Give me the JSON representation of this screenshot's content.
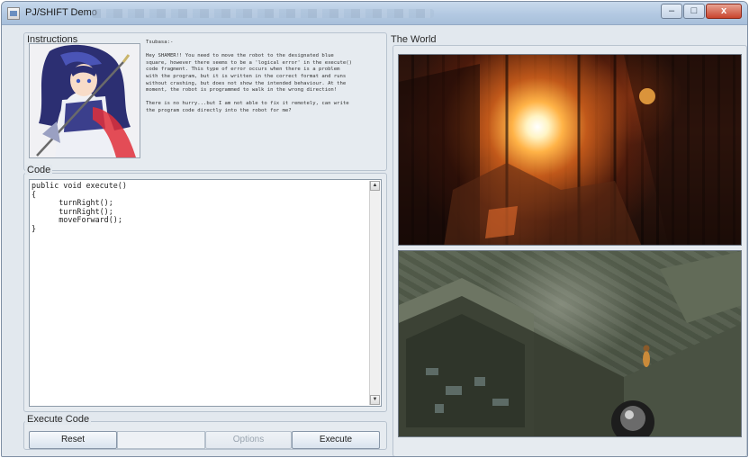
{
  "window": {
    "title": "PJ/SHIFT Demo",
    "controls": {
      "minimize": "–",
      "maximize": "□",
      "close": "x"
    }
  },
  "instructions": {
    "label": "Instructions",
    "portrait_icon": "anime-character-portrait",
    "text": "Tsubasa:-\n\nHey SHAMER!! You need to move the robot to the designated blue\nsquare, however there seems to be a 'logical error' in the execute()\ncode fragment. This type of error occurs when there is a problem\nwith the program, but it is written in the correct format and runs\nwithout crashing, but does not show the intended behaviour. At the\nmoment, the robot is programmed to walk in the wrong direction!\n\nThere is no hurry...but I am not able to fix it remotely, can write\nthe program code directly into the robot for me?"
  },
  "code": {
    "label": "Code",
    "content": "public void execute()\n{\n      turnRight();\n      turnRight();\n      moveForward();\n}"
  },
  "execute_code": {
    "label": "Execute Code",
    "reset_label": "Reset",
    "options_label": "Options",
    "execute_label": "Execute"
  },
  "world": {
    "label": "The World",
    "scenes": [
      "burning-building-scene",
      "isometric-game-map-scene"
    ]
  },
  "colors": {
    "window_bg": "#e2e8ee",
    "titlebar": "#b3c9e2",
    "close_button": "#c9442d"
  }
}
